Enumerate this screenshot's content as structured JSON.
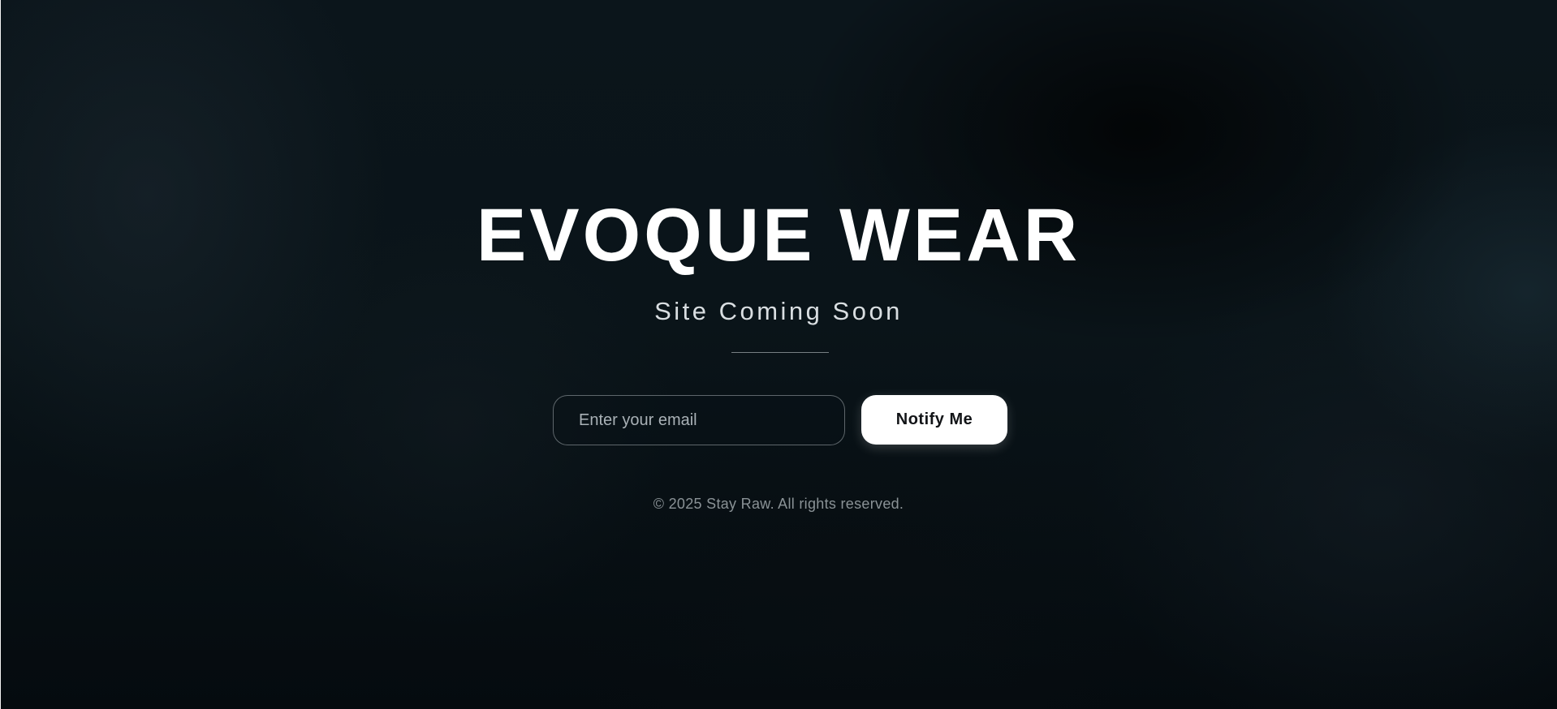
{
  "hero": {
    "title": "EVOQUE WEAR",
    "subtitle": "Site Coming Soon"
  },
  "signup": {
    "email_placeholder": "Enter your email",
    "email_value": "",
    "button_label": "Notify Me"
  },
  "footer": {
    "copyright": "© 2025 Stay Raw. All rights reserved."
  },
  "colors": {
    "background": "#0a1419",
    "title": "#ffffff",
    "button_bg": "#ffffff",
    "button_text": "#121417",
    "footer_text": "#8a9296"
  }
}
